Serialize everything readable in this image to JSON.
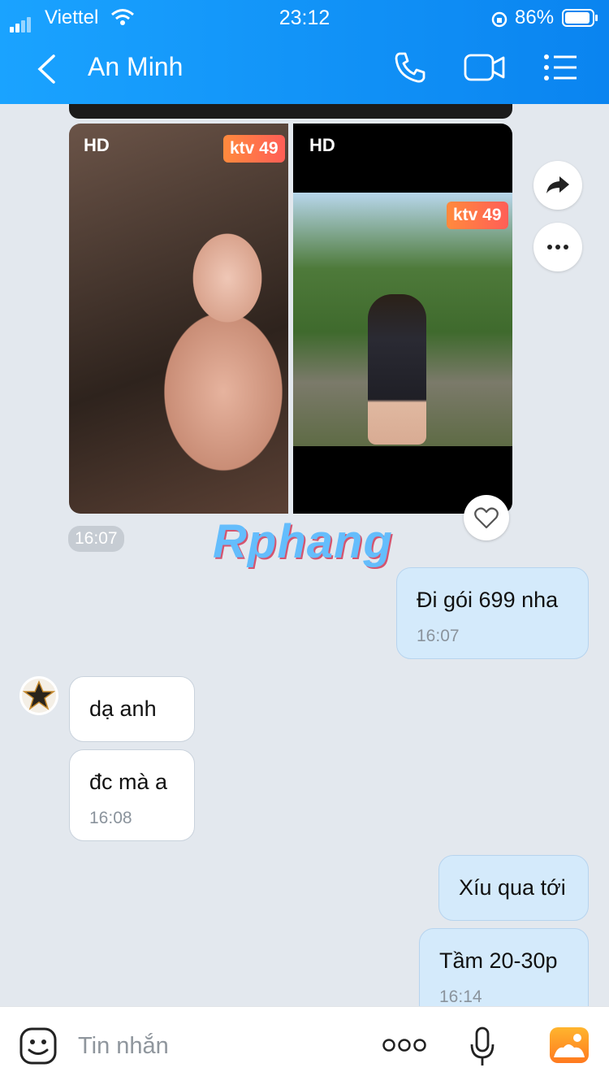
{
  "status_bar": {
    "carrier": "Viettel",
    "time": "23:12",
    "battery": "86%"
  },
  "header": {
    "title": "An Minh"
  },
  "messages": {
    "photo_left": {
      "hd": "HD",
      "badge": "ktv 49"
    },
    "photo_right": {
      "hd": "HD",
      "badge": "ktv 49"
    },
    "photo_time": "16:07",
    "watermark": "Rphang",
    "sent_1": {
      "text": "Đi gói 699 nha",
      "time": "16:07"
    },
    "recv_1": {
      "text": "dạ anh"
    },
    "recv_2": {
      "text": "đc mà a",
      "time": "16:08"
    },
    "sent_2": {
      "text": "Xíu qua tới"
    },
    "sent_3": {
      "text": "Tầm 20-30p",
      "time": "16:14"
    }
  },
  "input": {
    "placeholder": "Tin nhắn"
  },
  "colors": {
    "header": "#0a84f0",
    "sent_bubble": "#d4eafb",
    "badge": "#ff6b4a"
  }
}
